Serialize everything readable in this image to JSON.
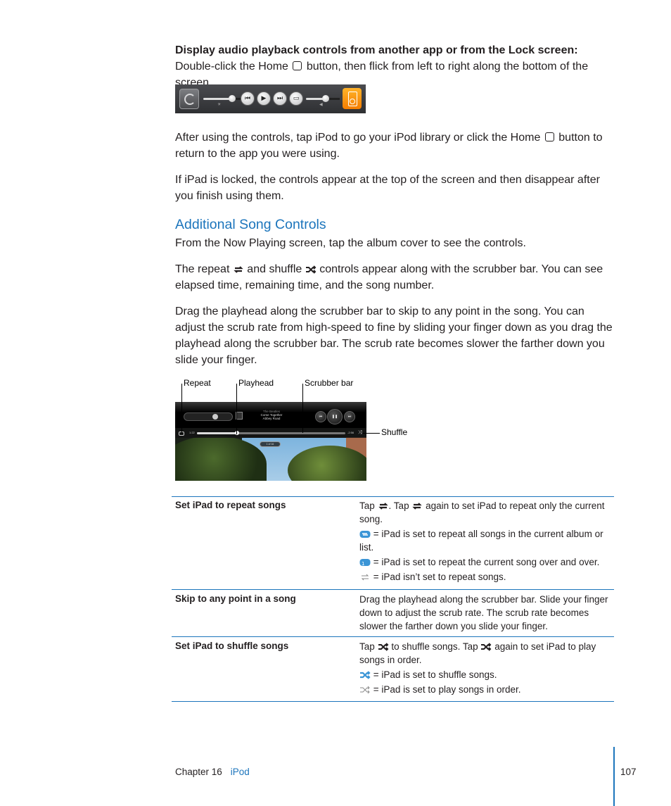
{
  "intro": {
    "bold_lead": "Display audio playback controls from another app or from the Lock screen:",
    "text_a": "Double-click the Home",
    "text_b": "button, then flick from left to right along the bottom of the screen."
  },
  "control_strip": {
    "buttons": [
      "rotation-lock",
      "brightness-slider",
      "previous",
      "play",
      "next",
      "airplay",
      "volume-slider",
      "ipod"
    ],
    "brightness_level": 0.65,
    "volume_level": 0.55,
    "glyphs": {
      "prev": "⏮",
      "play": "▶",
      "next": "⏭",
      "airplay": "▭"
    }
  },
  "para_after": {
    "text_a": "After using the controls, tap iPod to go your iPod library or click the Home",
    "text_b": "button to return to the app you were using."
  },
  "para_locked": "If iPad is locked, the controls appear at the top of the screen and then disappear after you finish using them.",
  "section": {
    "heading": "Additional Song Controls",
    "p1": "From the Now Playing screen, tap the album cover to see the controls.",
    "p2_a": "The repeat",
    "p2_b": "and shuffle",
    "p2_c": "controls appear along with the scrubber bar. You can see elapsed time, remaining time, and the song number.",
    "p3": "Drag the playhead along the scrubber bar to skip to any point in the song. You can adjust the scrub rate from high-speed to fine by sliding your finger down as you drag the playhead along the scrubber bar. The scrub rate becomes slower the farther down you slide your finger."
  },
  "figure": {
    "callouts": {
      "repeat": "Repeat",
      "playhead": "Playhead",
      "scrubber": "Scrubber bar",
      "shuffle": "Shuffle"
    },
    "artist": "The Beatles",
    "song": "Come Together",
    "album": "Abbey Road",
    "elapsed": "1:22",
    "remaining": "-2:56",
    "song_number": "1 of 16",
    "progress": 0.27,
    "glyphs": {
      "prev": "⏮",
      "pause": "❚❚",
      "next": "⏭",
      "shuffle": "⤨"
    }
  },
  "table": {
    "rows": [
      {
        "label": "Set iPad to repeat songs",
        "lines": [
          "Tap [repeat]. Tap [repeat] again to set iPad to repeat only the current song.",
          "[repeat-all] = iPad is set to repeat all songs in the current album or list.",
          "[repeat-one] = iPad is set to repeat the current song over and over.",
          "[repeat-off] = iPad isn’t set to repeat songs."
        ],
        "l1a": "Tap",
        "l1b": ". Tap",
        "l1c": "again to set iPad to repeat only the current song.",
        "l2": "= iPad is set to repeat all songs in the current album or list.",
        "l3": "= iPad is set to repeat the current song over and over.",
        "l4": "= iPad isn’t set to repeat songs."
      },
      {
        "label": "Skip to any point in a song",
        "l1": "Drag the playhead along the scrubber bar. Slide your finger down to adjust the scrub rate. The scrub rate becomes slower the farther down you slide your finger."
      },
      {
        "label": "Set iPad to shuffle songs",
        "l1a": "Tap",
        "l1b": "to shuffle songs. Tap",
        "l1c": "again to set iPad to play songs in order.",
        "l2": "= iPad is set to shuffle songs.",
        "l3": "= iPad is set to play songs in order."
      }
    ]
  },
  "footer": {
    "chapter": "Chapter 16",
    "section": "iPod",
    "page": "107"
  },
  "colors": {
    "accent": "#1c75bc",
    "text": "#231f20",
    "active_icon": "#3b95d6"
  }
}
